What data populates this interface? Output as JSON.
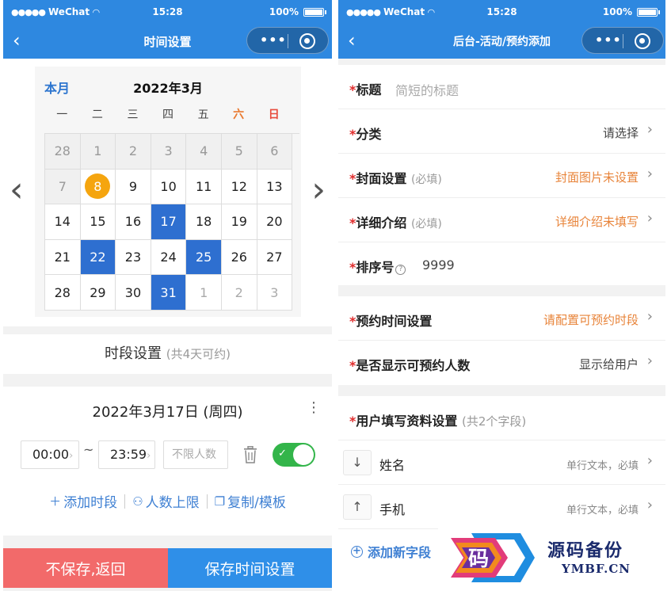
{
  "status_bar": {
    "carrier": "WeChat",
    "time": "15:28",
    "battery": "100%"
  },
  "left": {
    "nav_title": "时间设置",
    "calendar": {
      "this_month_label": "本月",
      "month_title": "2022年3月",
      "weekdays": [
        "一",
        "二",
        "三",
        "四",
        "五",
        "六",
        "日"
      ],
      "weeks": [
        [
          {
            "d": "28",
            "s": "other"
          },
          {
            "d": "1",
            "s": "past"
          },
          {
            "d": "2",
            "s": "past"
          },
          {
            "d": "3",
            "s": "past"
          },
          {
            "d": "4",
            "s": "past"
          },
          {
            "d": "5",
            "s": "past"
          },
          {
            "d": "6",
            "s": "past"
          }
        ],
        [
          {
            "d": "7",
            "s": "past"
          },
          {
            "d": "8",
            "s": "today"
          },
          {
            "d": "9",
            "s": ""
          },
          {
            "d": "10",
            "s": ""
          },
          {
            "d": "11",
            "s": ""
          },
          {
            "d": "12",
            "s": ""
          },
          {
            "d": "13",
            "s": ""
          }
        ],
        [
          {
            "d": "14",
            "s": ""
          },
          {
            "d": "15",
            "s": ""
          },
          {
            "d": "16",
            "s": ""
          },
          {
            "d": "17",
            "s": "selected"
          },
          {
            "d": "18",
            "s": ""
          },
          {
            "d": "19",
            "s": ""
          },
          {
            "d": "20",
            "s": ""
          }
        ],
        [
          {
            "d": "21",
            "s": ""
          },
          {
            "d": "22",
            "s": "selected"
          },
          {
            "d": "23",
            "s": ""
          },
          {
            "d": "24",
            "s": ""
          },
          {
            "d": "25",
            "s": "selected"
          },
          {
            "d": "26",
            "s": ""
          },
          {
            "d": "27",
            "s": ""
          }
        ],
        [
          {
            "d": "28",
            "s": ""
          },
          {
            "d": "29",
            "s": ""
          },
          {
            "d": "30",
            "s": ""
          },
          {
            "d": "31",
            "s": "selected"
          },
          {
            "d": "1",
            "s": "next-other"
          },
          {
            "d": "2",
            "s": "next-other"
          },
          {
            "d": "3",
            "s": "next-other"
          }
        ]
      ]
    },
    "slot_header": {
      "title": "时段设置",
      "sub": "(共4天可约)"
    },
    "day": {
      "title": "2022年3月17日 (周四)",
      "start_time": "00:00",
      "end_time": "23:59",
      "limit_placeholder": "不限人数",
      "toggle_on": true
    },
    "actions": {
      "add_slot": "添加时段",
      "people_limit": "人数上限",
      "copy_template": "复制/模板"
    },
    "bottom": {
      "back": "不保存,返回",
      "save": "保存时间设置"
    }
  },
  "right": {
    "nav_title": "后台-活动/预约添加",
    "basic_rows": {
      "title": {
        "label": "标题",
        "placeholder": "简短的标题"
      },
      "category": {
        "label": "分类",
        "value": "请选择"
      },
      "cover": {
        "label": "封面设置",
        "hint": "(必填)",
        "value": "封面图片未设置"
      },
      "detail": {
        "label": "详细介绍",
        "hint": "(必填)",
        "value": "详细介绍未填写"
      },
      "order": {
        "label": "排序号",
        "value": "9999"
      }
    },
    "time_rows": {
      "booking_time": {
        "label": "预约时间设置",
        "value": "请配置可预约时段"
      },
      "show_count": {
        "label": "是否显示可预约人数",
        "value": "显示给用户"
      }
    },
    "user_fields": {
      "label": "用户填写资料设置",
      "sub": "(共2个字段)",
      "items": [
        {
          "name": "姓名",
          "meta": "单行文本，必填",
          "sort_glyph": "↓"
        },
        {
          "name": "手机",
          "meta": "单行文本，必填",
          "sort_glyph": "↑"
        }
      ],
      "add_label": "添加新字段"
    }
  },
  "watermark": {
    "logo_char": "码",
    "text": "源码备份",
    "url": "YMBF.CN"
  },
  "colors": {
    "primary": "#2e88e0",
    "selected": "#2e6fd0",
    "today": "#f5a50f",
    "danger": "#f26a6a",
    "toggle": "#33b54a",
    "warning_text": "#e8843a"
  }
}
